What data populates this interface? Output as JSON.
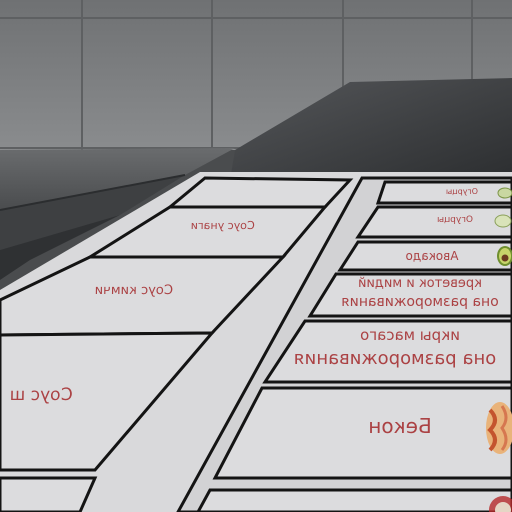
{
  "colors": {
    "label_text": "#a3282a",
    "card_fill": "#dcdcde",
    "border": "#141414",
    "wall": "#7d7f81",
    "counter": "#3a3c3e"
  },
  "left_panel": {
    "cells": [
      {
        "label": "Соус унаги"
      },
      {
        "label": "Соус кимчи"
      },
      {
        "label": "Соус ш"
      },
      {
        "label": ""
      }
    ]
  },
  "right_panel": {
    "cells": [
      {
        "label": "Огурцы",
        "icon": "cucumber-slice-icon"
      },
      {
        "label": "Огурцы",
        "icon": "cucumber-slice-icon"
      },
      {
        "label": "Авокадо",
        "icon": "avocado-icon"
      },
      {
        "line1": "креветок и мидий",
        "line2": "она размороживания"
      },
      {
        "line1": "икры масаго",
        "line2": "она размороживания"
      },
      {
        "label": "Бекон",
        "icon": "bacon-icon"
      },
      {
        "label": "",
        "icon": "round-food-icon"
      }
    ]
  }
}
